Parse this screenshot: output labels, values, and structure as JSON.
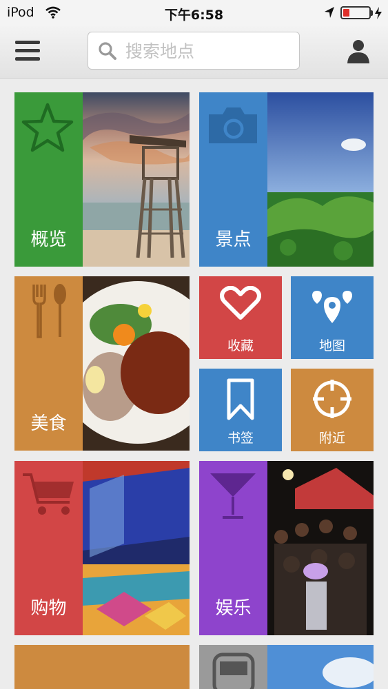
{
  "status_bar": {
    "carrier": "iPod",
    "time": "下午6:58",
    "battery_level": 0.25,
    "battery_color": "#e0302a"
  },
  "header": {
    "menu_icon": "hamburger-menu-icon",
    "search_placeholder": "搜索地点",
    "user_icon": "user-icon"
  },
  "tiles": {
    "overview": {
      "label": "概览",
      "icon": "star-icon",
      "color": "#3a9a3a"
    },
    "attractions": {
      "label": "景点",
      "icon": "camera-icon",
      "color": "#3f85c8"
    },
    "food": {
      "label": "美食",
      "icon": "fork-spoon-icon",
      "color": "#cd8a3f"
    },
    "favorites": {
      "label": "收藏",
      "icon": "heart-icon",
      "color": "#d24646"
    },
    "map": {
      "label": "地图",
      "icon": "map-pin-icon",
      "color": "#3f85c8"
    },
    "bookmarks": {
      "label": "书签",
      "icon": "bookmark-icon",
      "color": "#3f85c8"
    },
    "nearby": {
      "label": "附近",
      "icon": "crosshair-icon",
      "color": "#cd8a3f"
    },
    "shopping": {
      "label": "购物",
      "icon": "shopping-cart-icon",
      "color": "#d24646"
    },
    "entertainment": {
      "label": "娱乐",
      "icon": "cocktail-icon",
      "color": "#8e44cc"
    },
    "partial_left": {
      "color": "#cd8a3f"
    },
    "partial_right": {
      "icon": "bus-icon",
      "color": "#9a9a9a"
    }
  }
}
